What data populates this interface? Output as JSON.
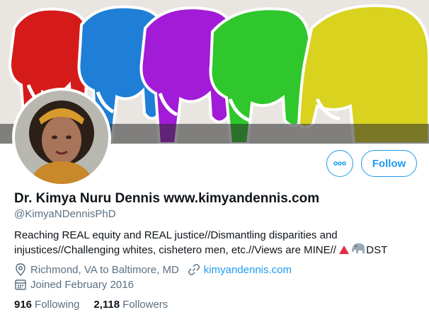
{
  "profile": {
    "name": "Dr. Kimya Nuru Dennis www.kimyandennis.com",
    "handle": "@KimyaNDennisPhD",
    "bio_text": "Reaching REAL equity and REAL justice//Dismantling disparities and injustices//Challenging whites, cishetero men, etc.//Views are MINE//",
    "bio_suffix": "DST",
    "bio_emojis": [
      "red-triangle-emoji",
      "elephant-emoji"
    ],
    "location": "Richmond, VA to Baltimore, MD",
    "website": "kimyandennis.com",
    "joined": "Joined February 2016",
    "following_count": "916",
    "following_label": "Following",
    "followers_count": "2,118",
    "followers_label": "Followers"
  },
  "actions": {
    "follow_label": "Follow",
    "more_icon": "more-options-icon"
  },
  "colors": {
    "accent": "#1d9bf0",
    "secondary_text": "#5b7083",
    "primary_text": "#0f1419"
  }
}
